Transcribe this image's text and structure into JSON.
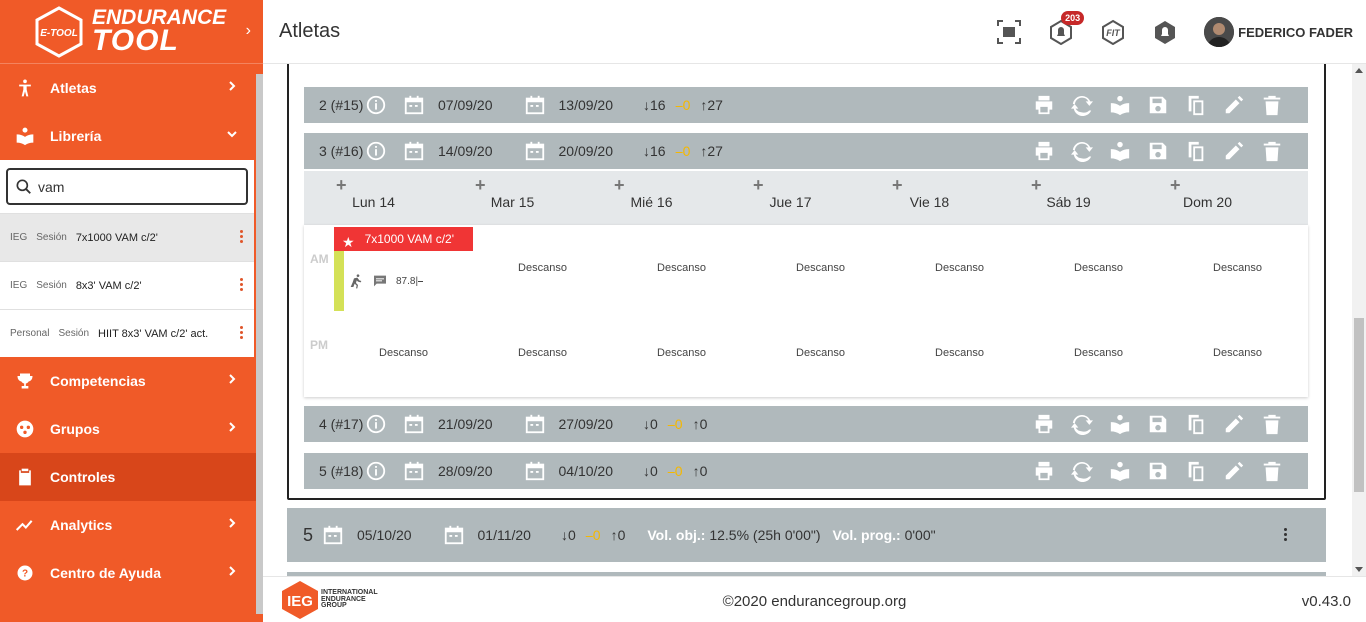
{
  "brand": {
    "line1": "ENDURANCE",
    "line2": "TOOL",
    "badge": "E-TOOL"
  },
  "header": {
    "title": "Atletas",
    "notifications_count": "203",
    "user_name": "FEDERICO FADER"
  },
  "nav": {
    "atletas": "Atletas",
    "libreria": "Librería",
    "competencias": "Competencias",
    "grupos": "Grupos",
    "controles": "Controles",
    "analytics": "Analytics",
    "ayuda": "Centro de Ayuda"
  },
  "library": {
    "search_value": "vam",
    "items": [
      {
        "source": "IEG",
        "type": "Sesión",
        "name": "7x1000 VAM c/2'"
      },
      {
        "source": "IEG",
        "type": "Sesión",
        "name": "8x3' VAM c/2'"
      },
      {
        "source": "Personal",
        "type": "Sesión",
        "name": "HIIT 8x3' VAM c/2' act."
      }
    ]
  },
  "weeks": [
    {
      "label": "2 (#15)",
      "start": "07/09/20",
      "end": "13/09/20",
      "down": "↓16",
      "mid": "⎯0",
      "up": "↑27"
    },
    {
      "label": "3 (#16)",
      "start": "14/09/20",
      "end": "20/09/20",
      "down": "↓16",
      "mid": "⎯0",
      "up": "↑27"
    },
    {
      "label": "4 (#17)",
      "start": "21/09/20",
      "end": "27/09/20",
      "down": "↓0",
      "mid": "⎯0",
      "up": "↑0"
    },
    {
      "label": "5 (#18)",
      "start": "28/09/20",
      "end": "04/10/20",
      "down": "↓0",
      "mid": "⎯0",
      "up": "↑0"
    }
  ],
  "days": [
    "Lun 14",
    "Mar 15",
    "Mié 16",
    "Jue 17",
    "Vie 18",
    "Sáb 19",
    "Dom 20"
  ],
  "calendar": {
    "am_label": "AM",
    "pm_label": "PM",
    "rest_label": "Descanso",
    "session": {
      "title": "7x1000 VAM c/2'",
      "metric": "87.8|⎯"
    }
  },
  "period": {
    "number": "5",
    "start": "05/10/20",
    "end": "01/11/20",
    "down": "↓0",
    "mid": "⎯0",
    "up": "↑0",
    "vol_obj_label": "Vol. obj.:",
    "vol_obj_value": "12.5% (25h 0'00\")",
    "vol_prog_label": "Vol. prog.:",
    "vol_prog_value": "0'00\""
  },
  "footer": {
    "logo_line1": "INTERNATIONAL",
    "logo_line2": "ENDURANCE",
    "logo_line3": "GROUP",
    "copyright": "©2020 endurancegroup.org",
    "version": "v0.43.0"
  },
  "colors": {
    "brand_orange": "#f05a28",
    "row_gray": "#b0b9bc",
    "session_red": "#f03535",
    "accent_yellow": "#f5b800"
  }
}
